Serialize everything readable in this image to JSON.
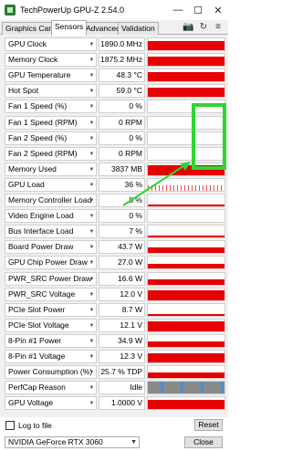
{
  "window": {
    "title": "TechPowerUp GPU-Z 2.54.0",
    "minimize": "—",
    "maximize": "☐",
    "close": "✕"
  },
  "tabs": [
    "Graphics Card",
    "Sensors",
    "Advanced",
    "Validation"
  ],
  "active_tab": "Sensors",
  "toolbar": {
    "camera": "📷",
    "refresh": "↻",
    "menu": "≡"
  },
  "sensors": [
    {
      "label": "GPU Clock",
      "value": "1890.0 MHz",
      "graph": "full"
    },
    {
      "label": "Memory Clock",
      "value": "1875.2 MHz",
      "graph": "full"
    },
    {
      "label": "GPU Temperature",
      "value": "48.3 °C",
      "graph": "full"
    },
    {
      "label": "Hot Spot",
      "value": "59.0 °C",
      "graph": "full"
    },
    {
      "label": "Fan 1 Speed (%)",
      "value": "0 %",
      "graph": "empty"
    },
    {
      "label": "Fan 1 Speed (RPM)",
      "value": "0 RPM",
      "graph": "empty"
    },
    {
      "label": "Fan 2 Speed (%)",
      "value": "0 %",
      "graph": "empty"
    },
    {
      "label": "Fan 2 Speed (RPM)",
      "value": "0 RPM",
      "graph": "empty"
    },
    {
      "label": "Memory Used",
      "value": "3837 MB",
      "graph": "full"
    },
    {
      "label": "GPU Load",
      "value": "36 %",
      "graph": "spikes"
    },
    {
      "label": "Memory Controller Load",
      "value": "8 %",
      "graph": "low"
    },
    {
      "label": "Video Engine Load",
      "value": "0 %",
      "graph": "empty"
    },
    {
      "label": "Bus Interface Load",
      "value": "7 %",
      "graph": "low"
    },
    {
      "label": "Board Power Draw",
      "value": "43.7 W",
      "graph": "half"
    },
    {
      "label": "GPU Chip Power Draw",
      "value": "27.0 W",
      "graph": "half"
    },
    {
      "label": "PWR_SRC Power Draw",
      "value": "16.6 W",
      "graph": "half"
    },
    {
      "label": "PWR_SRC Voltage",
      "value": "12.0 V",
      "graph": "full"
    },
    {
      "label": "PCIe Slot Power",
      "value": "8.7 W",
      "graph": "low"
    },
    {
      "label": "PCIe Slot Voltage",
      "value": "12.1 V",
      "graph": "full"
    },
    {
      "label": "8-Pin #1 Power",
      "value": "34.9 W",
      "graph": "half"
    },
    {
      "label": "8-Pin #1 Voltage",
      "value": "12.3 V",
      "graph": "full"
    },
    {
      "label": "Power Consumption (%)",
      "value": "25.7 % TDP",
      "graph": "half"
    },
    {
      "label": "PerfCap Reason",
      "value": "Idle",
      "graph": "perfcap"
    },
    {
      "label": "GPU Voltage",
      "value": "1.0000 V",
      "graph": "full"
    }
  ],
  "dropdown_glyph": "▼",
  "log_to_file": "Log to file",
  "reset": "Reset",
  "gpu_name": "NVIDIA GeForce RTX 3060",
  "close_button": "Close",
  "colors": {
    "graph": "#e80000",
    "annotation": "#2fd62f",
    "perfcap_idle": "#8a8a8a",
    "perfcap_other": "#4a8fd6"
  }
}
